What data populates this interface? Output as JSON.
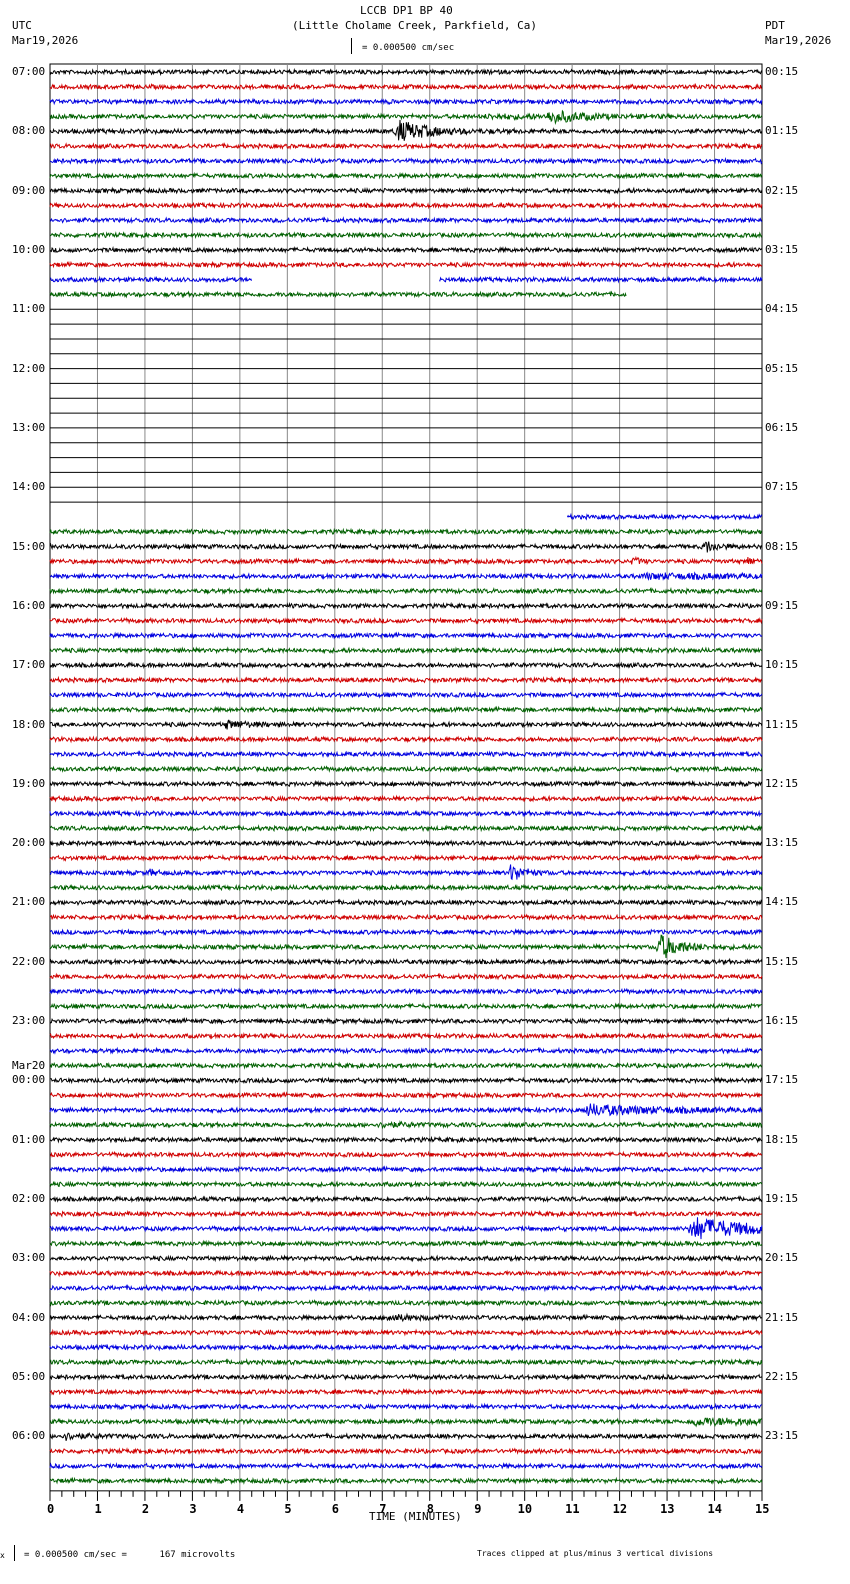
{
  "chart_data": {
    "type": "line",
    "title": "LCCB DP1 BP 40",
    "subtitle": "(Little Cholame Creek, Parkfield, Ca)",
    "left_tz": "UTC",
    "right_tz": "PDT",
    "left_date": "Mar19,2026",
    "right_date": "Mar19,2026",
    "next_date_label": "Mar20",
    "scale_label": "= 0.000500 cm/sec",
    "footer_scale": "= 0.000500 cm/sec =      167 microvolts",
    "footer_prefix": "x",
    "clip_note": "Traces clipped at plus/minus 3 vertical divisions",
    "xlabel": "TIME (MINUTES)",
    "xlim": [
      0,
      15
    ],
    "xticks": [
      "0",
      "1",
      "2",
      "3",
      "4",
      "5",
      "6",
      "7",
      "8",
      "9",
      "10",
      "11",
      "12",
      "13",
      "14",
      "15"
    ],
    "rows_per_hour": 4,
    "trace_colors": [
      "#000000",
      "#d00000",
      "#0000e0",
      "#006000"
    ],
    "left_labels": [
      "07:00",
      "08:00",
      "09:00",
      "10:00",
      "11:00",
      "12:00",
      "13:00",
      "14:00",
      "15:00",
      "16:00",
      "17:00",
      "18:00",
      "19:00",
      "20:00",
      "21:00",
      "22:00",
      "23:00",
      "00:00",
      "01:00",
      "02:00",
      "03:00",
      "04:00",
      "05:00",
      "06:00"
    ],
    "right_labels": [
      "00:15",
      "01:15",
      "02:15",
      "03:15",
      "04:15",
      "05:15",
      "06:15",
      "07:15",
      "08:15",
      "09:15",
      "10:15",
      "11:15",
      "12:15",
      "13:15",
      "14:15",
      "15:15",
      "16:15",
      "17:15",
      "18:15",
      "19:15",
      "20:15",
      "21:15",
      "22:15",
      "23:15"
    ],
    "data_segments": [
      {
        "row": 14,
        "start": 0,
        "end": 4.25
      },
      {
        "row": 14,
        "start": 8.2,
        "end": 15
      },
      {
        "row": 15,
        "start": 0,
        "end": 12.15
      },
      {
        "row": 30,
        "start": 10.9,
        "end": 15
      }
    ],
    "gap_rows": [
      16,
      29
    ],
    "events": [
      {
        "row": 3,
        "minute": 10.5,
        "amp": 6,
        "dur": 0.6
      },
      {
        "row": 3,
        "minute": 9.2,
        "amp": 1.5,
        "dur": 1.2
      },
      {
        "row": 4,
        "minute": 7.3,
        "amp": 11,
        "dur": 0.6
      },
      {
        "row": 32,
        "minute": 13.8,
        "amp": 6,
        "dur": 0.2
      },
      {
        "row": 33,
        "minute": 12.3,
        "amp": 5,
        "dur": 0.1
      },
      {
        "row": 33,
        "minute": 14.7,
        "amp": 4,
        "dur": 0.1
      },
      {
        "row": 34,
        "minute": 12.5,
        "amp": 2,
        "dur": 2.5
      },
      {
        "row": 44,
        "minute": 3.7,
        "amp": 3.5,
        "dur": 0.5
      },
      {
        "row": 54,
        "minute": 9.7,
        "amp": 9,
        "dur": 0.25
      },
      {
        "row": 54,
        "minute": 2.1,
        "amp": 3,
        "dur": 0.1
      },
      {
        "row": 59,
        "minute": 12.8,
        "amp": 14,
        "dur": 0.4
      },
      {
        "row": 70,
        "minute": 11.3,
        "amp": 5,
        "dur": 1.5
      },
      {
        "row": 71,
        "minute": 7.0,
        "amp": 2,
        "dur": 0.5
      },
      {
        "row": 78,
        "minute": 13.5,
        "amp": 11,
        "dur": 1.2
      },
      {
        "row": 84,
        "minute": 7.1,
        "amp": 3,
        "dur": 0.5
      },
      {
        "row": 91,
        "minute": 13.5,
        "amp": 3,
        "dur": 2.0
      },
      {
        "row": 92,
        "minute": 0.3,
        "amp": 2.5,
        "dur": 0.5
      }
    ]
  }
}
